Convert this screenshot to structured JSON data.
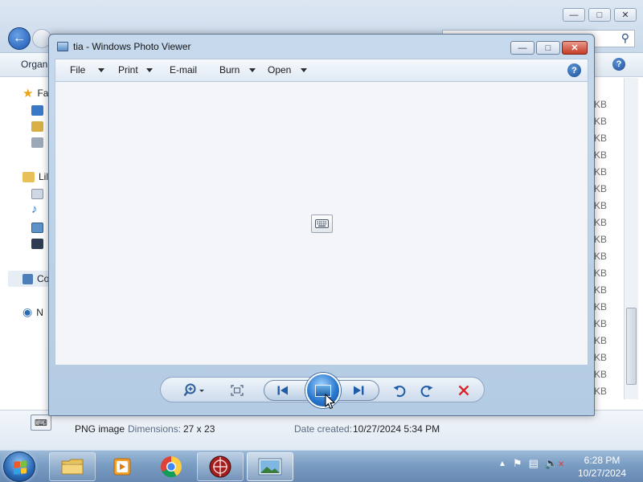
{
  "explorer": {
    "organize_label": "Organ",
    "nav": {
      "favorites_label": "Fa",
      "libraries_label": "Lil",
      "computer_label": "Co",
      "network_label": "N"
    },
    "size_unit": "KB",
    "size_cells": [
      "KB",
      "KB",
      "KB",
      "KB",
      "KB",
      "KB",
      "KB",
      "KB",
      "KB",
      "KB",
      "KB",
      "KB",
      "KB",
      "KB",
      "KB",
      "KB",
      "KB",
      "KB"
    ],
    "details": {
      "file_type": "PNG image",
      "dimensions_label": "Dimensions:",
      "dimensions_value": "27 x 23",
      "date_created_label": "Date created:",
      "date_created_value": "10/27/2024 5:34 PM"
    }
  },
  "photo_viewer": {
    "title": "tia - Windows Photo Viewer",
    "menu": {
      "file": "File",
      "print": "Print",
      "email": "E-mail",
      "burn": "Burn",
      "open": "Open"
    },
    "help_glyph": "?",
    "image_dimensions": "27 x 23"
  },
  "taskbar": {
    "time": "6:28 PM",
    "date": "10/27/2024"
  },
  "colors": {
    "window_frame": "#b3cbe3",
    "close_red": "#c43a24",
    "accent_blue": "#2a79d0",
    "delete_red": "#d8242a"
  },
  "icons": [
    "search-icon",
    "help-icon",
    "star-icon",
    "zoom-icon",
    "fit-window-icon",
    "previous-icon",
    "slideshow-icon",
    "next-icon",
    "rotate-left-icon",
    "rotate-right-icon",
    "delete-icon",
    "keyboard-icon"
  ]
}
